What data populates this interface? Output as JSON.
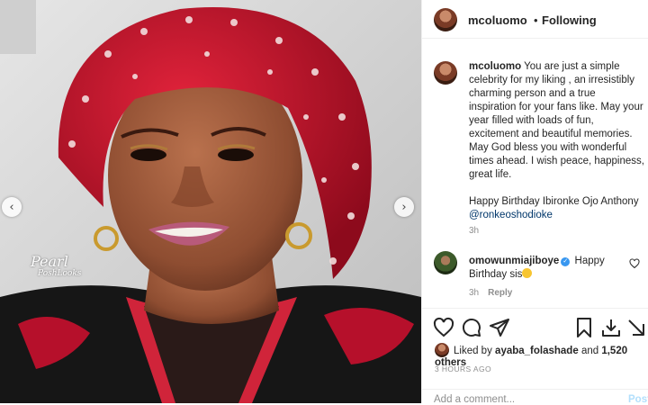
{
  "photo": {
    "watermark_line1": "Pearl",
    "watermark_line2": "PoshLooks",
    "prev_icon": "chevron-left-icon",
    "next_icon": "chevron-right-icon",
    "prev_glyph": "‹",
    "next_glyph": "›"
  },
  "header": {
    "username": "mcoluomo",
    "separator": "•",
    "follow_status": "Following"
  },
  "caption": {
    "username": "mcoluomo",
    "text1": "You are just a simple celebrity for my liking , an irresistibly charming person and a true inspiration for your fans like. May your year filled with loads of fun, excitement and beautiful memories.",
    "text2": "May God bless you with wonderful times ahead. I wish peace, happiness, great life.",
    "text3": "Happy Birthday Ibironke Ojo Anthony",
    "mention": "@ronkeoshodioke",
    "time": "3h"
  },
  "comment": {
    "username": "omowunmiajiboye",
    "verified_glyph": "✓",
    "text": "Happy Birthday sis",
    "time": "3h",
    "reply_label": "Reply"
  },
  "actions": {
    "icons": [
      "heart-icon",
      "comment-icon",
      "share-icon",
      "save-icon",
      "download-icon",
      "more-icon"
    ]
  },
  "likes": {
    "prefix": "Liked by",
    "user": "ayaba_folashade",
    "conjunction": "and",
    "others": "1,520 others"
  },
  "timestamp": "3 HOURS AGO",
  "add_comment": {
    "placeholder": "Add a comment...",
    "post_label": "Post"
  },
  "colors": {
    "accent_link": "#00376b",
    "verified": "#3897f0",
    "post_disabled": "#b2dffc",
    "gele_red": "#c8102e"
  }
}
